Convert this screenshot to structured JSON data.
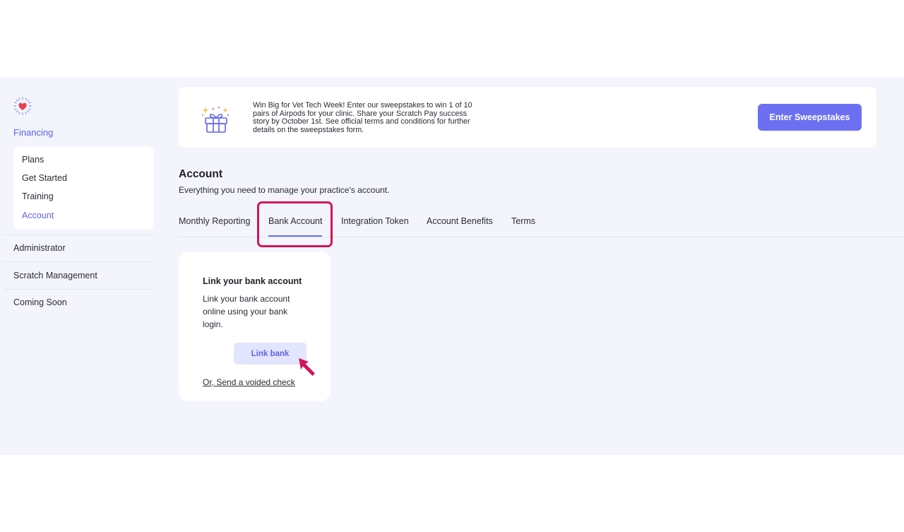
{
  "sidebar": {
    "section_title": "Financing",
    "subnav": [
      {
        "label": "Plans"
      },
      {
        "label": "Get Started"
      },
      {
        "label": "Training"
      },
      {
        "label": "Account",
        "active": true
      }
    ],
    "items": [
      {
        "label": "Administrator"
      },
      {
        "label": "Scratch Management"
      },
      {
        "label": "Coming Soon"
      }
    ]
  },
  "banner": {
    "text": "Win Big for Vet Tech Week! Enter our sweepstakes to win 1 of 10 pairs of Airpods for your clinic. Share your Scratch Pay success story by October 1st. See official terms and conditions for further details on the sweepstakes form.",
    "cta_label": "Enter Sweepstakes",
    "icon": "gift-icon"
  },
  "page": {
    "title": "Account",
    "subtitle": "Everything you need to manage your practice's account."
  },
  "tabs": [
    {
      "label": "Monthly Reporting"
    },
    {
      "label": "Bank Account",
      "active": true
    },
    {
      "label": "Integration Token"
    },
    {
      "label": "Account Benefits"
    },
    {
      "label": "Terms"
    }
  ],
  "card": {
    "title": "Link your bank account",
    "description": "Link your bank account online using your bank login.",
    "button_label": "Link bank",
    "secondary_link": "Or, Send a voided check"
  },
  "colors": {
    "accent": "#6d6ff2",
    "accent_text": "#5f63e8",
    "highlight": "#d4145a",
    "background": "#f3f4fc",
    "logo_heart": "#e8414f"
  }
}
